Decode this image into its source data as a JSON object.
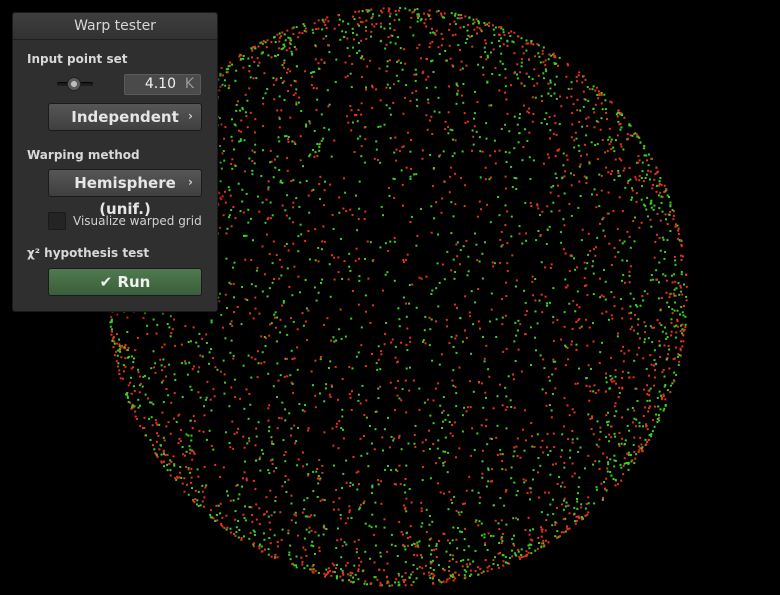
{
  "window": {
    "title": "Warp tester"
  },
  "input_point_set": {
    "label": "Input point set",
    "sample_count_value": "4.10",
    "sample_count_unit": "K",
    "sampler_button": "Independent"
  },
  "warping_method": {
    "label": "Warping method",
    "method_button": "Hemisphere (unif.)",
    "visualize_grid_label": "Visualize warped grid",
    "visualize_grid_checked": false
  },
  "hypothesis_test": {
    "label": "χ² hypothesis test",
    "run_label": "Run"
  },
  "colors": {
    "background": "#000000",
    "point_green": "#3dd11f",
    "point_red": "#e8321a",
    "run_button": "#3f653f"
  },
  "chart_data": {
    "type": "scatter",
    "description_units": "unit disk projection of warped samples",
    "point_count": 4100,
    "coloring": "red to green gradient by sample index",
    "xlim": [
      -1,
      1
    ],
    "ylim": [
      -1,
      1
    ]
  }
}
